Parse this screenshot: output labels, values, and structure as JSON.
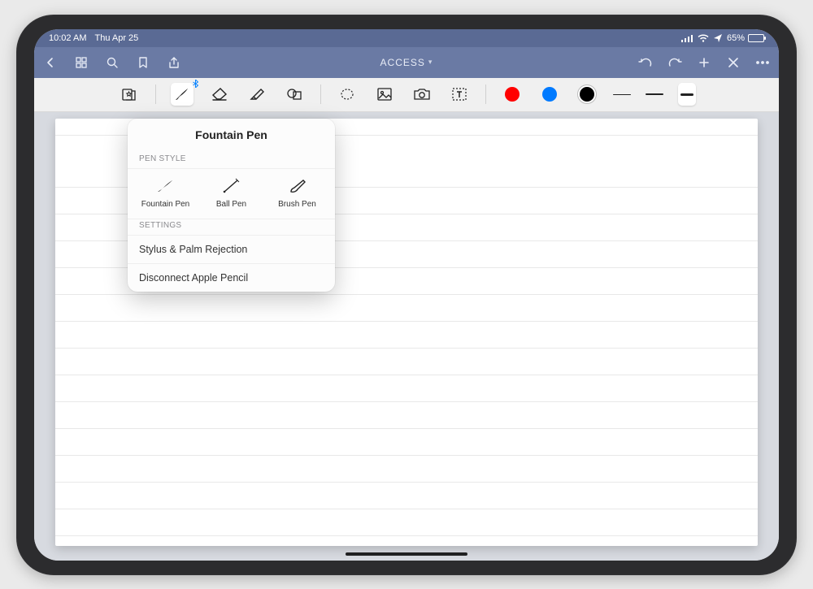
{
  "status": {
    "time": "10:02 AM",
    "date": "Thu Apr 25",
    "battery_pct": "65%"
  },
  "navbar": {
    "title": "ACCESS"
  },
  "toolbar": {
    "colors": {
      "red": "#ff0000",
      "blue": "#007aff",
      "black": "#000000"
    }
  },
  "popover": {
    "title": "Fountain Pen",
    "pen_style_label": "PEN STYLE",
    "pens": {
      "fountain": "Fountain Pen",
      "ball": "Ball Pen",
      "brush": "Brush Pen"
    },
    "settings_label": "SETTINGS",
    "settings_items": {
      "stylus": "Stylus & Palm Rejection",
      "disconnect": "Disconnect Apple Pencil"
    }
  }
}
